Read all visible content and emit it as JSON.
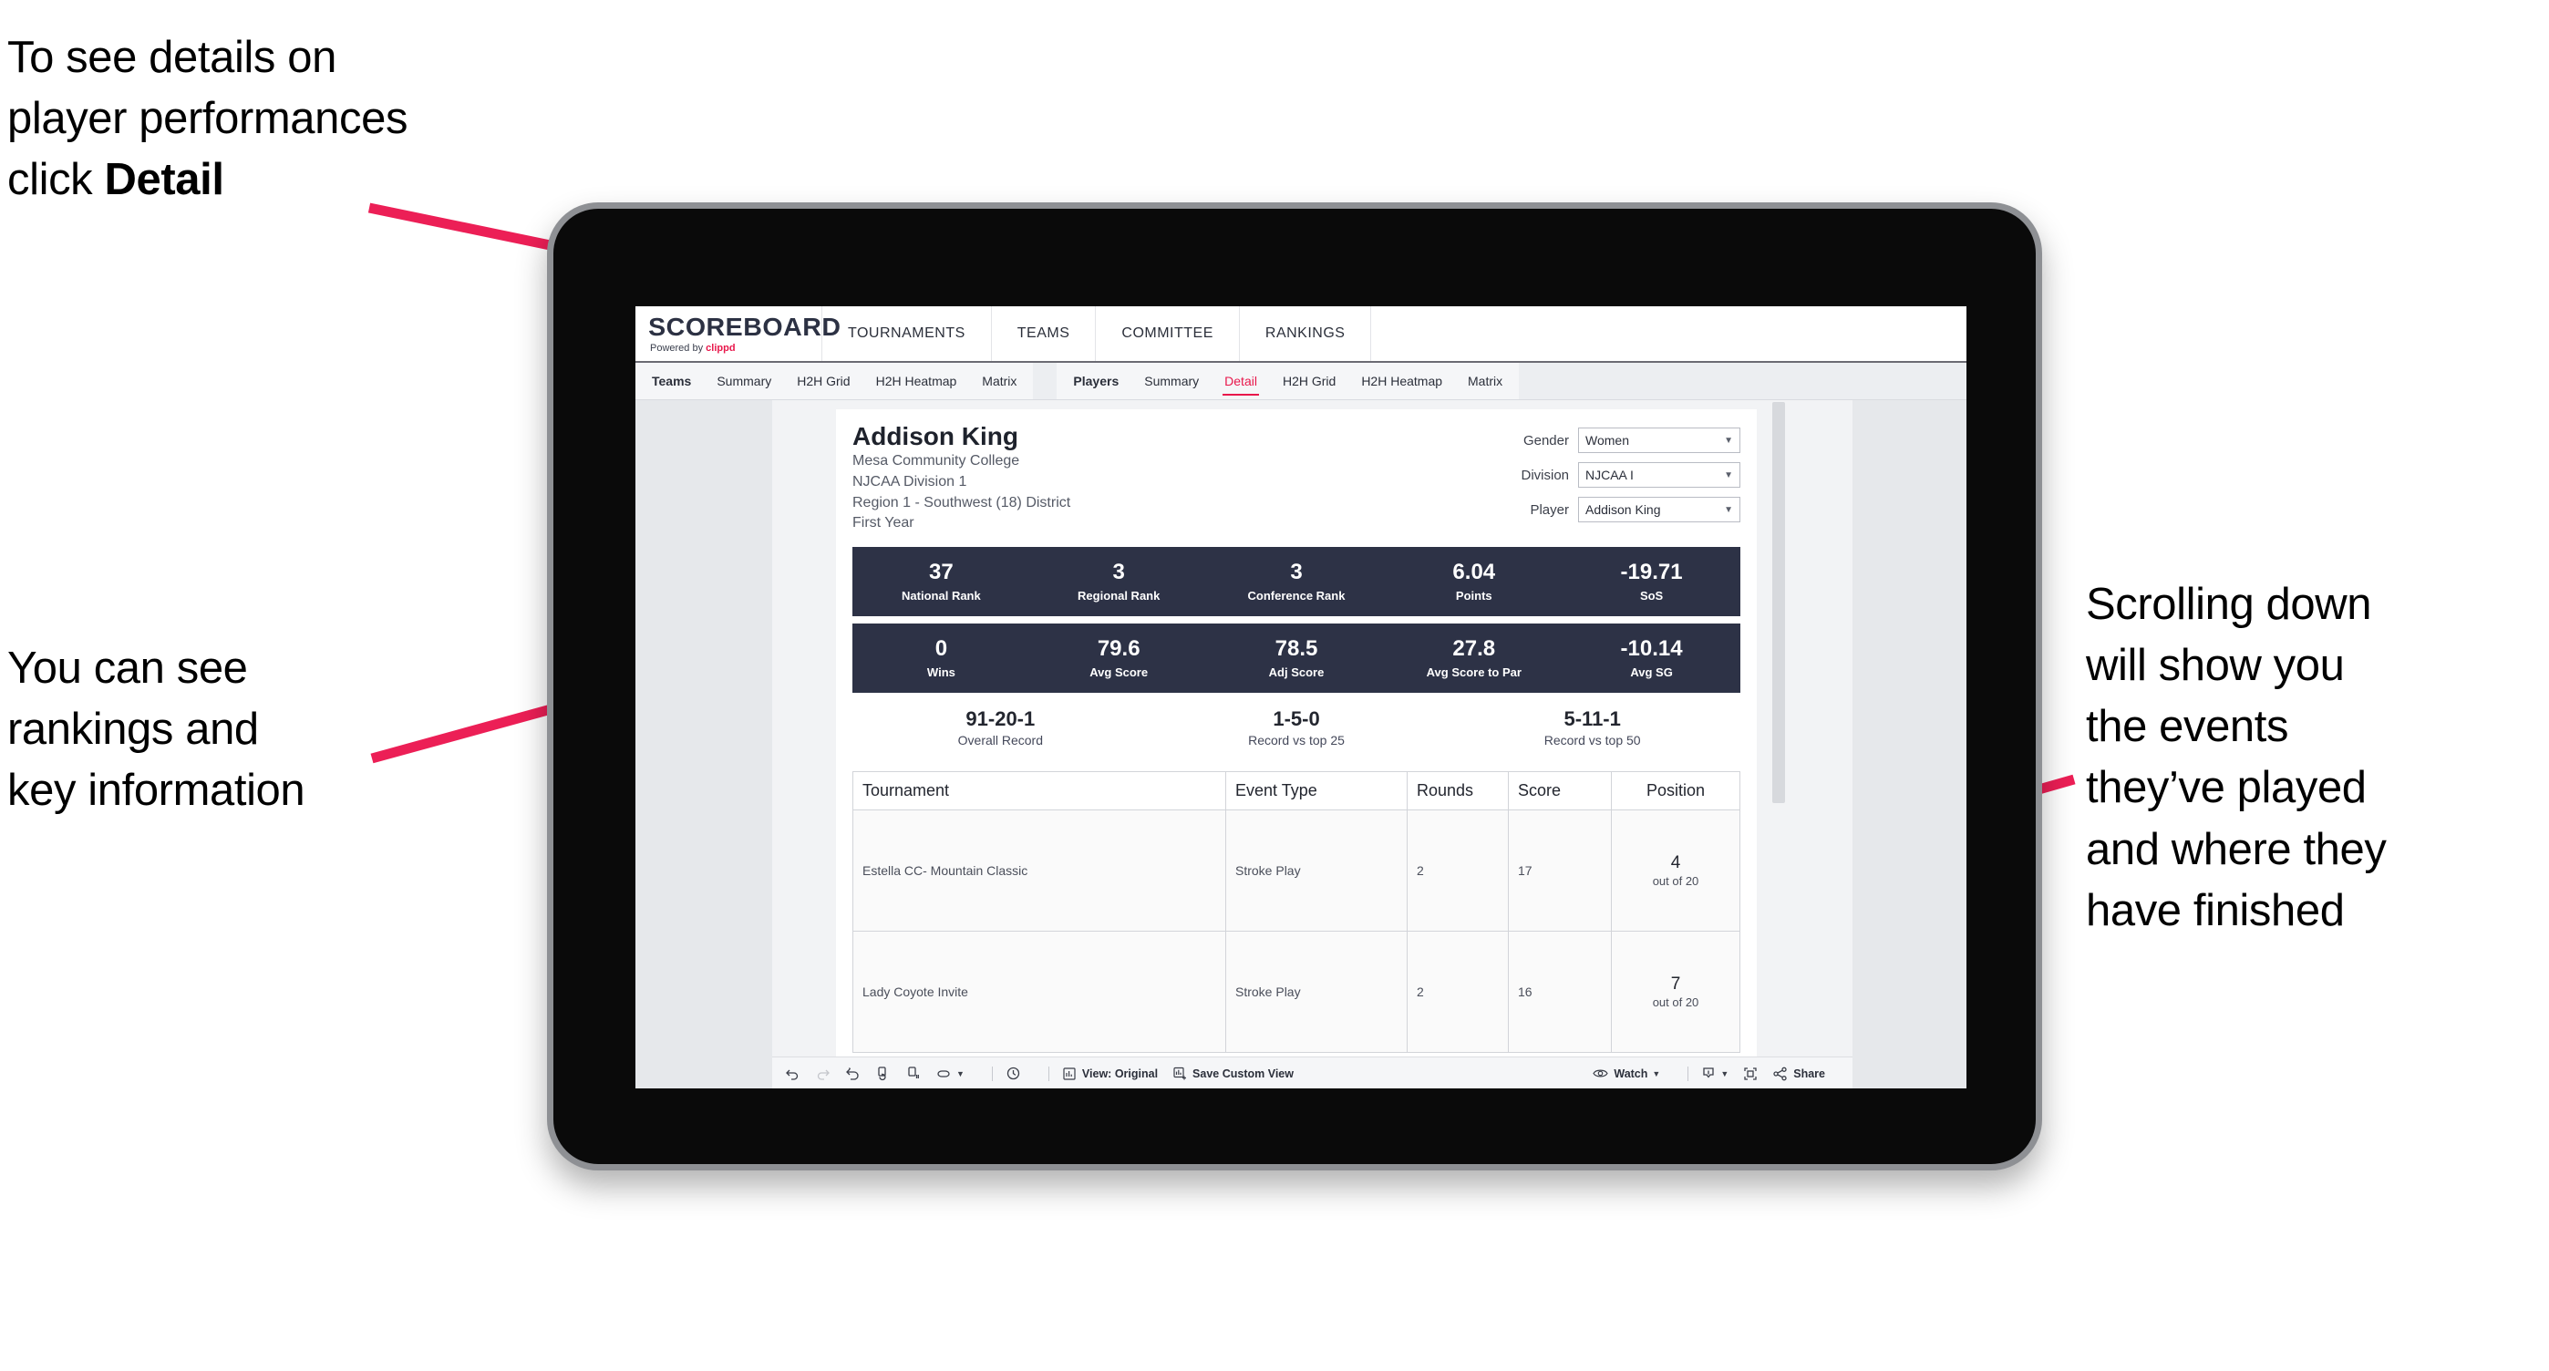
{
  "annotations": {
    "top_left": {
      "line1": "To see details on",
      "line2": "player performances",
      "line3_prefix": "click ",
      "line3_bold": "Detail"
    },
    "bottom_left": {
      "line1": "You can see",
      "line2": "rankings and",
      "line3": "key information"
    },
    "right": {
      "line1": "Scrolling down",
      "line2": "will show you",
      "line3": "the events",
      "line4": "they’ve played",
      "line5": "and where they",
      "line6": "have finished"
    }
  },
  "app": {
    "logo_main": "SCOREBOARD",
    "logo_sub_prefix": "Powered by ",
    "logo_sub_brand": "clippd",
    "nav": [
      {
        "label": "TOURNAMENTS"
      },
      {
        "label": "TEAMS"
      },
      {
        "label": "COMMITTEE"
      },
      {
        "label": "RANKINGS"
      }
    ]
  },
  "tabs": {
    "team_group": [
      {
        "label": "Teams",
        "bold": true,
        "active": false
      },
      {
        "label": "Summary",
        "bold": false,
        "active": false
      },
      {
        "label": "H2H Grid",
        "bold": false,
        "active": false
      },
      {
        "label": "H2H Heatmap",
        "bold": false,
        "active": false
      },
      {
        "label": "Matrix",
        "bold": false,
        "active": false
      }
    ],
    "player_group": [
      {
        "label": "Players",
        "bold": true,
        "active": false
      },
      {
        "label": "Summary",
        "bold": false,
        "active": false
      },
      {
        "label": "Detail",
        "bold": false,
        "active": true
      },
      {
        "label": "H2H Grid",
        "bold": false,
        "active": false
      },
      {
        "label": "H2H Heatmap",
        "bold": false,
        "active": false
      },
      {
        "label": "Matrix",
        "bold": false,
        "active": false
      }
    ]
  },
  "player": {
    "name": "Addison King",
    "school": "Mesa Community College",
    "division": "NJCAA Division 1",
    "region": "Region 1 - Southwest (18) District",
    "year": "First Year"
  },
  "filters": [
    {
      "label": "Gender",
      "value": "Women"
    },
    {
      "label": "Division",
      "value": "NJCAA I"
    },
    {
      "label": "Player",
      "value": "Addison King"
    }
  ],
  "stats_row_1": [
    {
      "value": "37",
      "label": "National Rank"
    },
    {
      "value": "3",
      "label": "Regional Rank"
    },
    {
      "value": "3",
      "label": "Conference Rank"
    },
    {
      "value": "6.04",
      "label": "Points"
    },
    {
      "value": "-19.71",
      "label": "SoS"
    }
  ],
  "stats_row_2": [
    {
      "value": "0",
      "label": "Wins"
    },
    {
      "value": "79.6",
      "label": "Avg Score"
    },
    {
      "value": "78.5",
      "label": "Adj Score"
    },
    {
      "value": "27.8",
      "label": "Avg Score to Par"
    },
    {
      "value": "-10.14",
      "label": "Avg SG"
    }
  ],
  "records": [
    {
      "value": "91-20-1",
      "label": "Overall Record"
    },
    {
      "value": "1-5-0",
      "label": "Record vs top 25"
    },
    {
      "value": "5-11-1",
      "label": "Record vs top 50"
    }
  ],
  "events_table": {
    "headers": [
      "Tournament",
      "Event Type",
      "Rounds",
      "Score",
      "Position"
    ],
    "rows": [
      {
        "tournament": "Estella CC- Mountain Classic",
        "event_type": "Stroke Play",
        "rounds": "2",
        "score": "17",
        "position": "4",
        "position_of": "out of 20"
      },
      {
        "tournament": "Lady Coyote Invite",
        "event_type": "Stroke Play",
        "rounds": "2",
        "score": "16",
        "position": "7",
        "position_of": "out of 20"
      }
    ]
  },
  "toolbar": {
    "view_label": "View: Original",
    "save_label": "Save Custom View",
    "watch_label": "Watch",
    "share_label": "Share"
  },
  "colors": {
    "accent_pink": "#e8174b",
    "stat_bar_navy": "#2d3246",
    "arrow_pink": "#ec1f56"
  }
}
